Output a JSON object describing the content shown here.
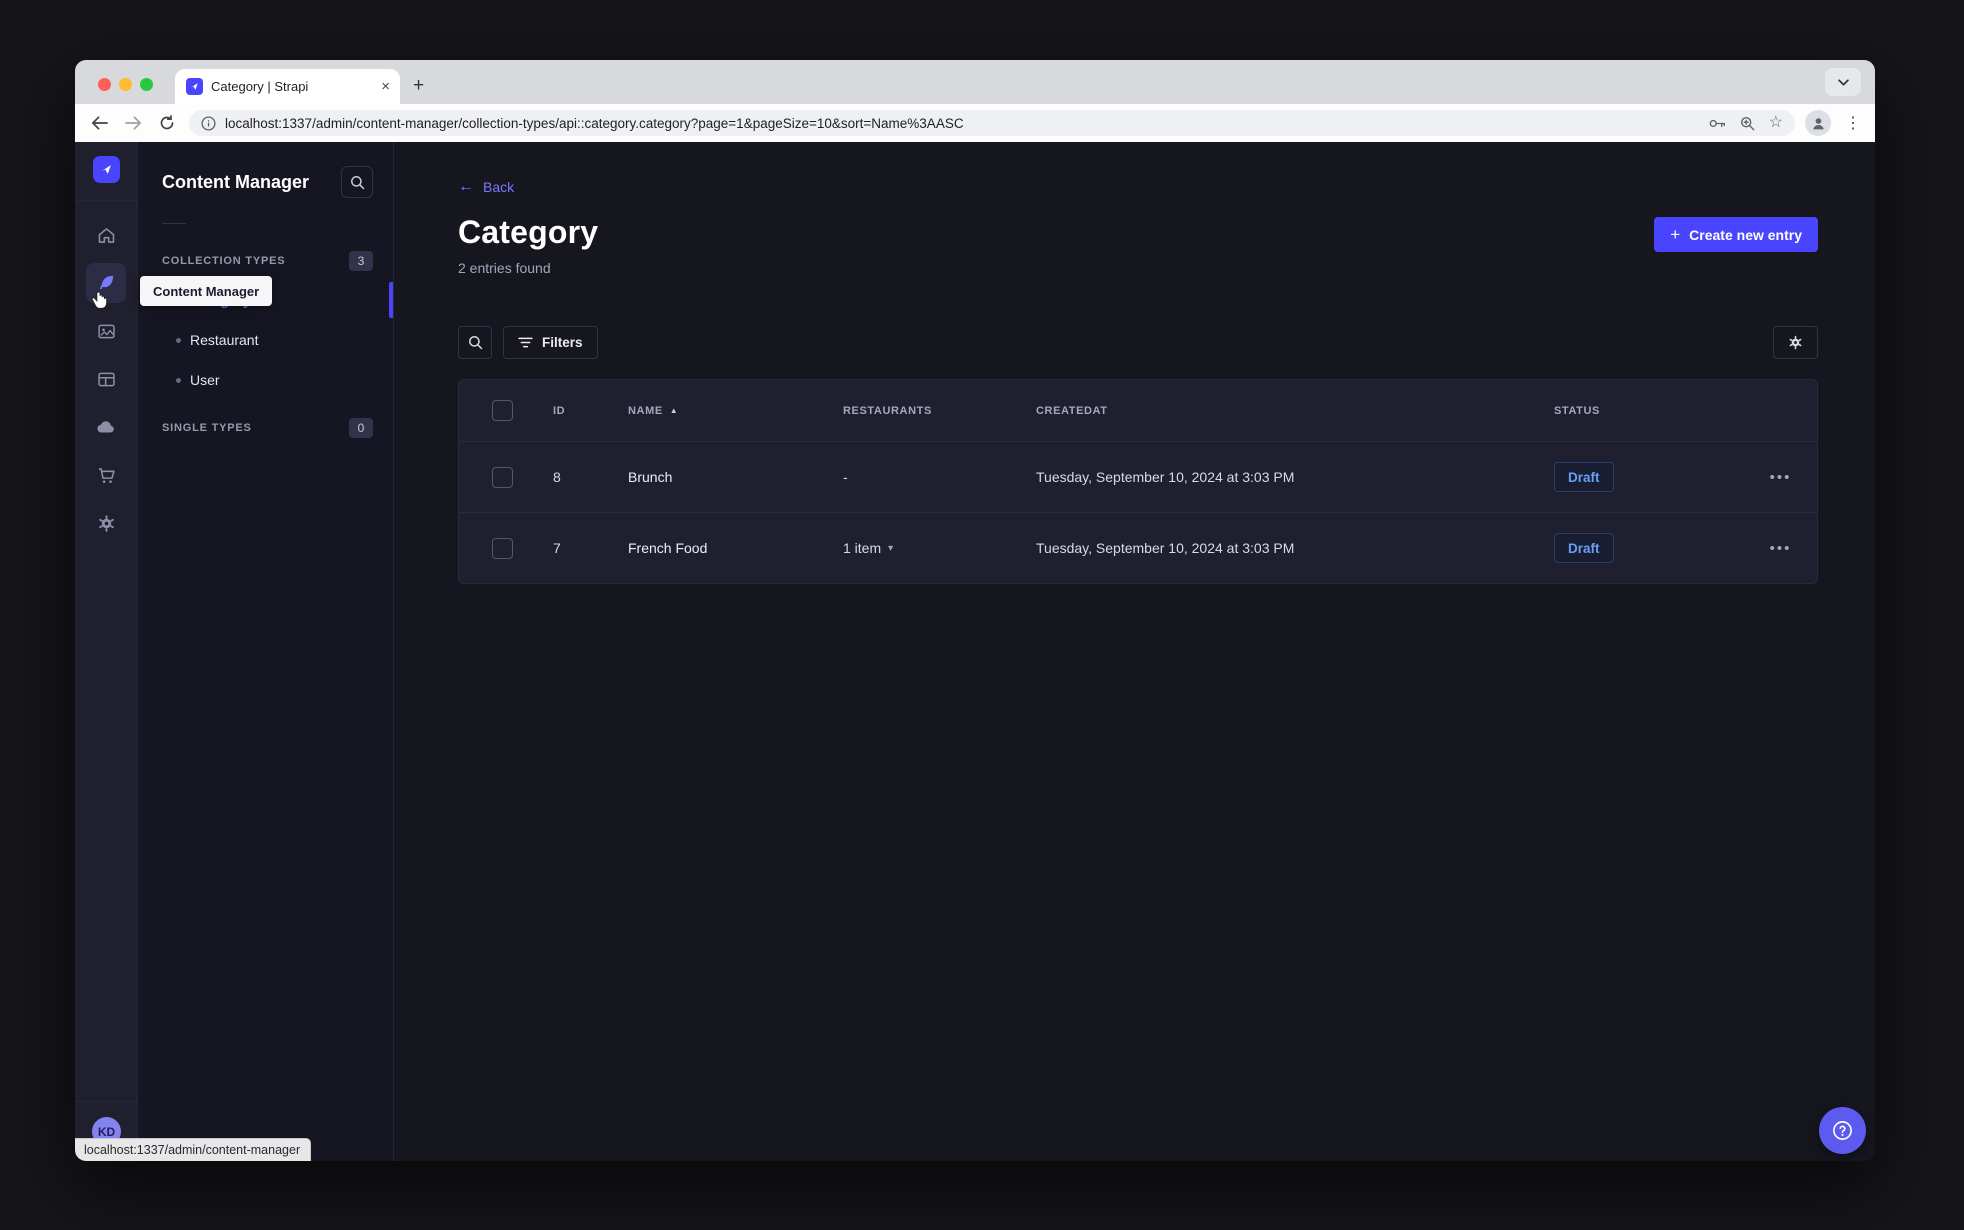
{
  "browser": {
    "tab_title": "Category | Strapi",
    "url": "localhost:1337/admin/content-manager/collection-types/api::category.category?page=1&pageSize=10&sort=Name%3AASC",
    "status_bubble": "localhost:1337/admin/content-manager"
  },
  "icons": {
    "tab_close": "×",
    "new_tab": "+",
    "kebab_menu": "⋮",
    "bookmark_star": "☆",
    "back_arrow": "←",
    "plus": "+",
    "sort_asc": "▲",
    "caret_down": "▾",
    "row_actions": "•••"
  },
  "colors": {
    "primary": "#4945ff",
    "primary_light": "#7b79ff",
    "draft_text": "#6a9ff5",
    "traffic_red": "#ff5f57",
    "traffic_yellow": "#febc2e",
    "traffic_green": "#28c840"
  },
  "rail": {
    "tooltip": "Content Manager",
    "items": [
      {
        "name": "home"
      },
      {
        "name": "content-manager",
        "active": true
      },
      {
        "name": "media-library"
      },
      {
        "name": "content-type-builder"
      },
      {
        "name": "strapi-cloud"
      },
      {
        "name": "marketplace"
      },
      {
        "name": "settings"
      }
    ],
    "avatar_initials": "KD"
  },
  "subnav": {
    "title": "Content Manager",
    "sections": [
      {
        "label": "COLLECTION TYPES",
        "badge": "3",
        "items": [
          {
            "label": "Category",
            "active": true
          },
          {
            "label": "Restaurant"
          },
          {
            "label": "User"
          }
        ]
      },
      {
        "label": "SINGLE TYPES",
        "badge": "0",
        "items": []
      }
    ]
  },
  "main": {
    "back_label": "Back",
    "title": "Category",
    "subtitle": "2 entries found",
    "create_button_label": "Create new entry",
    "filters_button_label": "Filters",
    "table": {
      "columns": {
        "id": "ID",
        "name": "NAME",
        "restaurants": "RESTAURANTS",
        "createdat": "CREATEDAT",
        "status": "STATUS"
      },
      "sorted_column": "NAME",
      "sort_direction": "asc",
      "rows": [
        {
          "id": "8",
          "name": "Brunch",
          "restaurants": "-",
          "createdat": "Tuesday, September 10, 2024 at 3:03 PM",
          "status": "Draft"
        },
        {
          "id": "7",
          "name": "French Food",
          "restaurants": "1 item",
          "createdat": "Tuesday, September 10, 2024 at 3:03 PM",
          "status": "Draft"
        }
      ]
    }
  }
}
